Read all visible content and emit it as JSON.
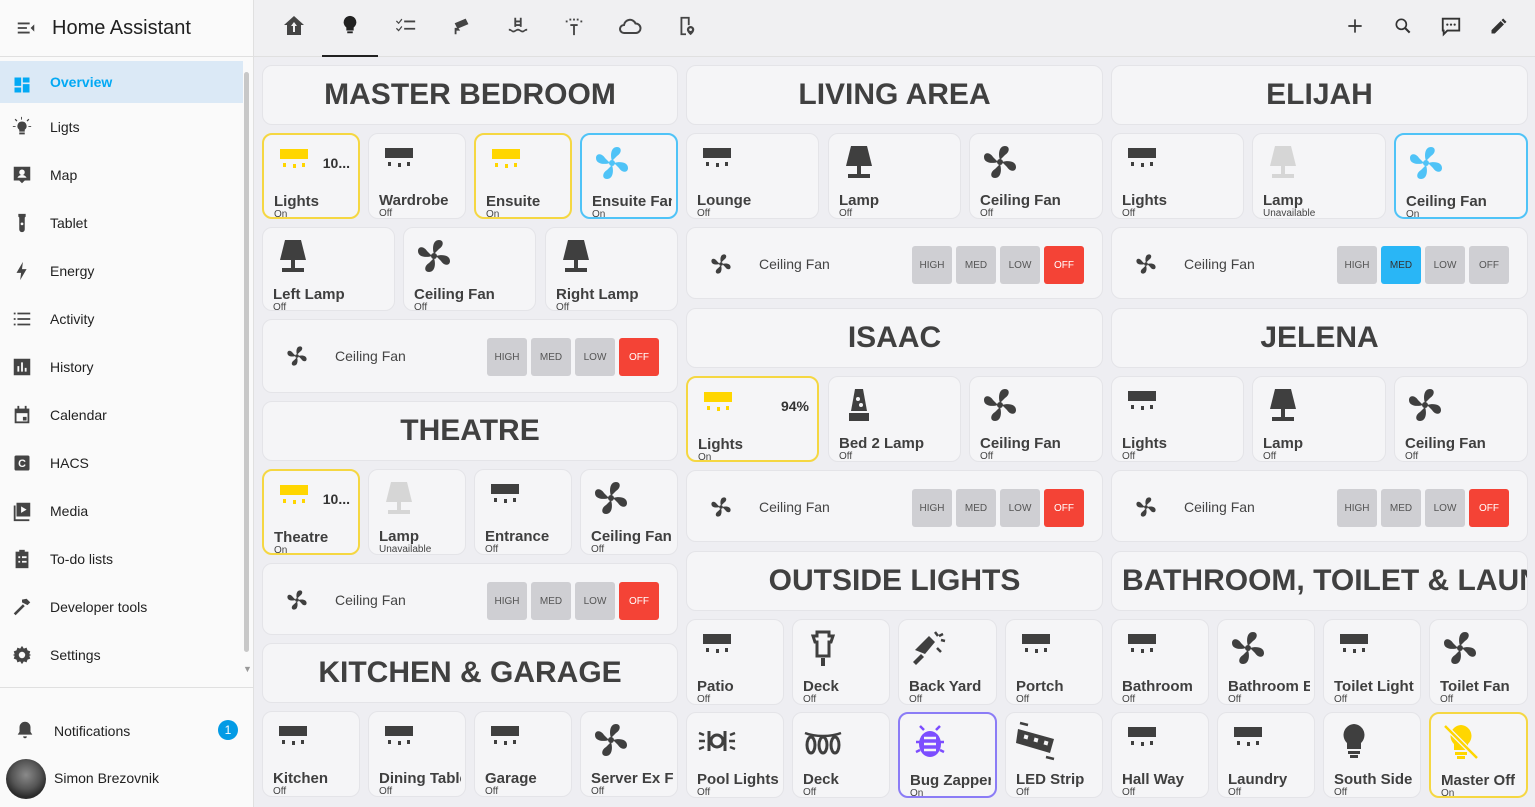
{
  "app": {
    "title": "Home Assistant"
  },
  "sidebar": {
    "items": [
      {
        "label": "Overview",
        "icon": "overview-icon"
      },
      {
        "label": "Ligts",
        "icon": "lightbulb-icon"
      },
      {
        "label": "Map",
        "icon": "map-icon"
      },
      {
        "label": "Tablet",
        "icon": "tablet-icon"
      },
      {
        "label": "Energy",
        "icon": "lightning-icon"
      },
      {
        "label": "Activity",
        "icon": "list-icon"
      },
      {
        "label": "History",
        "icon": "chart-icon"
      },
      {
        "label": "Calendar",
        "icon": "calendar-icon"
      },
      {
        "label": "HACS",
        "icon": "hacs-icon"
      },
      {
        "label": "Media",
        "icon": "media-icon"
      },
      {
        "label": "To-do lists",
        "icon": "clipboard-icon"
      },
      {
        "label": "Developer tools",
        "icon": "hammer-icon"
      },
      {
        "label": "Settings",
        "icon": "gear-icon"
      }
    ],
    "notifications": {
      "label": "Notifications",
      "count": "1"
    },
    "user": {
      "name": "Simon Brezovnik"
    }
  },
  "tabs": [
    "home-icon",
    "lightbulb-icon",
    "checklist-icon",
    "cctv-icon",
    "pool-icon",
    "sprinkler-icon",
    "cloud-icon",
    "phone-location-icon"
  ],
  "actions": [
    "plus-icon",
    "search-icon",
    "assist-icon",
    "pencil-icon"
  ],
  "colors": {
    "accent": "#03a9f4",
    "on_yellow": "#ffd600",
    "fan_blue": "#4fc3f7",
    "off_red": "#f44336",
    "zapper_purple": "#7c4dff",
    "icon_grey": "#3f3f3f",
    "unavailable": "#d6d6d6"
  },
  "fan_buttons": {
    "high": "HIGH",
    "med": "MED",
    "low": "LOW",
    "off": "OFF"
  },
  "sections": {
    "master_bedroom": {
      "title": "MASTER BEDROOM",
      "tiles": [
        {
          "name": "Lights",
          "state": "On",
          "value": "10...",
          "icon": "light-yellow"
        },
        {
          "name": "Wardrobe",
          "state": "Off",
          "icon": "light"
        },
        {
          "name": "Ensuite",
          "state": "On",
          "icon": "light-yellow"
        },
        {
          "name": "Ensuite Fan",
          "state": "On",
          "icon": "fan-blue"
        },
        {
          "name": "Left Lamp",
          "state": "Off",
          "icon": "lamp"
        },
        {
          "name": "Ceiling Fan",
          "state": "Off",
          "icon": "fan"
        },
        {
          "name": "Right Lamp",
          "state": "Off",
          "icon": "lamp"
        }
      ],
      "fan": {
        "name": "Ceiling Fan",
        "active": "off"
      }
    },
    "theatre": {
      "title": "THEATRE",
      "tiles": [
        {
          "name": "Theatre",
          "state": "On",
          "value": "10...",
          "icon": "light-yellow"
        },
        {
          "name": "Lamp",
          "state": "Unavailable",
          "icon": "lamp-unavail"
        },
        {
          "name": "Entrance",
          "state": "Off",
          "icon": "light"
        },
        {
          "name": "Ceiling Fan",
          "state": "Off",
          "icon": "fan"
        }
      ],
      "fan": {
        "name": "Ceiling Fan",
        "active": "off"
      }
    },
    "kitchen": {
      "title": "KITCHEN & GARAGE",
      "tiles": [
        {
          "name": "Kitchen",
          "state": "Off",
          "icon": "light"
        },
        {
          "name": "Dining Table",
          "state": "Off",
          "icon": "light"
        },
        {
          "name": "Garage",
          "state": "Off",
          "icon": "light"
        },
        {
          "name": "Server Ex Fan",
          "state": "Off",
          "icon": "fan"
        }
      ]
    },
    "living": {
      "title": "LIVING AREA",
      "tiles": [
        {
          "name": "Lounge",
          "state": "Off",
          "icon": "light"
        },
        {
          "name": "Lamp",
          "state": "Off",
          "icon": "lamp"
        },
        {
          "name": "Ceiling Fan",
          "state": "Off",
          "icon": "fan"
        }
      ],
      "fan": {
        "name": "Ceiling Fan",
        "active": "off"
      }
    },
    "elijah": {
      "title": "ELIJAH",
      "tiles": [
        {
          "name": "Lights",
          "state": "Off",
          "icon": "light"
        },
        {
          "name": "Lamp",
          "state": "Unavailable",
          "icon": "lamp-unavail"
        },
        {
          "name": "Ceiling Fan",
          "state": "On",
          "icon": "fan-blue"
        }
      ],
      "fan": {
        "name": "Ceiling Fan",
        "active": "med"
      }
    },
    "isaac": {
      "title": "ISAAC",
      "tiles": [
        {
          "name": "Lights",
          "state": "On",
          "value": "94%",
          "icon": "light-yellow"
        },
        {
          "name": "Bed 2 Lamp",
          "state": "Off",
          "icon": "lavalamp"
        },
        {
          "name": "Ceiling Fan",
          "state": "Off",
          "icon": "fan"
        }
      ],
      "fan": {
        "name": "Ceiling Fan",
        "active": "off"
      }
    },
    "jelena": {
      "title": "JELENA",
      "tiles": [
        {
          "name": "Lights",
          "state": "Off",
          "icon": "light"
        },
        {
          "name": "Lamp",
          "state": "Off",
          "icon": "lamp"
        },
        {
          "name": "Ceiling Fan",
          "state": "Off",
          "icon": "fan"
        }
      ],
      "fan": {
        "name": "Ceiling Fan",
        "active": "off"
      }
    },
    "outside": {
      "title": "OUTSIDE LIGHTS",
      "tiles": [
        {
          "name": "Patio",
          "state": "Off",
          "icon": "light"
        },
        {
          "name": "Deck",
          "state": "Off",
          "icon": "lantern"
        },
        {
          "name": "Back Yard",
          "state": "Off",
          "icon": "floodlight"
        },
        {
          "name": "Portch",
          "state": "Off",
          "icon": "light"
        },
        {
          "name": "Pool Lights",
          "state": "Off",
          "icon": "poollight"
        },
        {
          "name": "Deck",
          "state": "Off",
          "icon": "stringlights"
        },
        {
          "name": "Bug Zapper",
          "state": "On",
          "icon": "bug"
        },
        {
          "name": "LED Strip",
          "state": "Off",
          "icon": "ledstrip"
        }
      ]
    },
    "bathroom": {
      "title": "BATHROOM, TOILET & LAUNDRY",
      "tiles": [
        {
          "name": "Bathroom",
          "state": "Off",
          "icon": "light"
        },
        {
          "name": "Bathroom Exhaust",
          "state": "Off",
          "icon": "fan"
        },
        {
          "name": "Toilet Light",
          "state": "Off",
          "icon": "light"
        },
        {
          "name": "Toilet Fan",
          "state": "Off",
          "icon": "fan"
        },
        {
          "name": "Hall Way",
          "state": "Off",
          "icon": "light"
        },
        {
          "name": "Laundry",
          "state": "Off",
          "icon": "light"
        },
        {
          "name": "South Side",
          "state": "Off",
          "icon": "bulb"
        },
        {
          "name": "Master Off",
          "state": "On",
          "icon": "bulb-off-yellow"
        }
      ]
    }
  }
}
